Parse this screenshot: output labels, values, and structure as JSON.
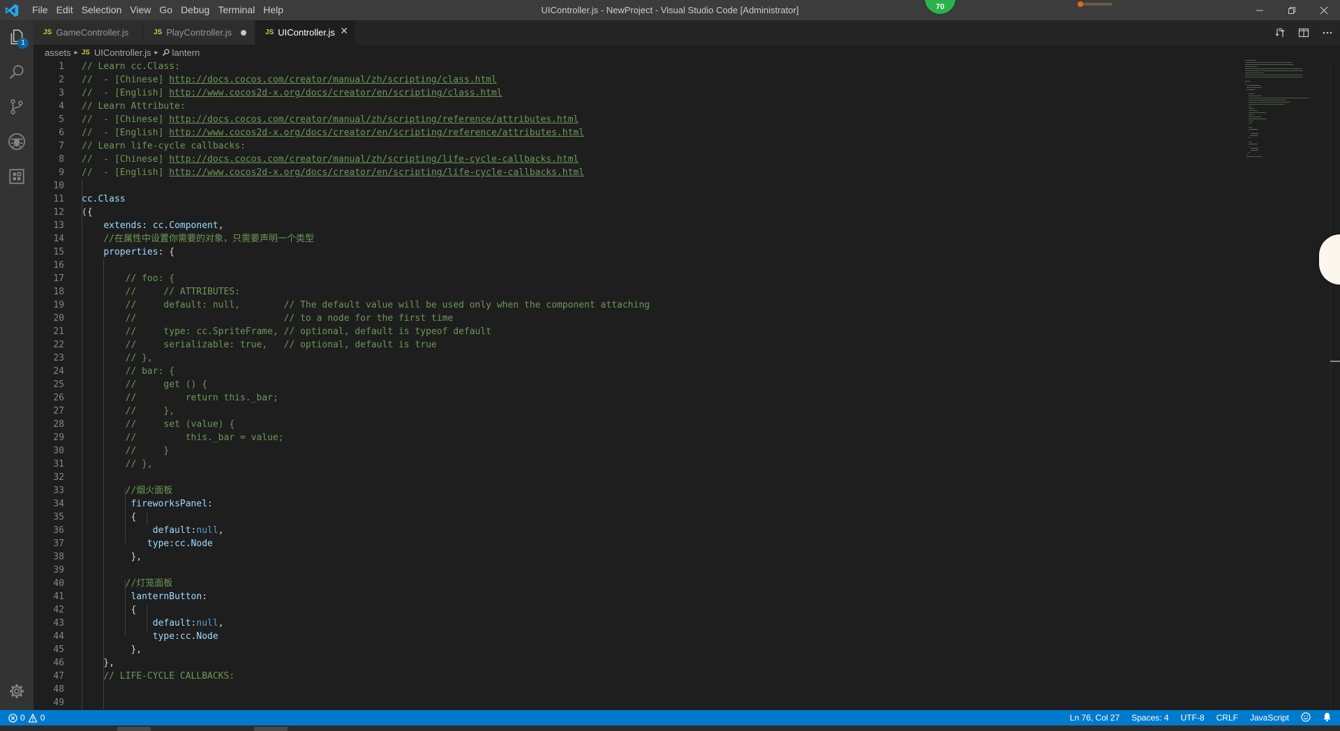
{
  "menu": [
    "File",
    "Edit",
    "Selection",
    "View",
    "Go",
    "Debug",
    "Terminal",
    "Help"
  ],
  "window_title": "UIController.js - NewProject - Visual Studio Code [Administrator]",
  "overlay_badge": "70",
  "activity": {
    "explorer_badge": "1"
  },
  "tabs": [
    {
      "label": "GameController.js",
      "icon": "JS",
      "state": "normal"
    },
    {
      "label": "PlayController.js",
      "icon": "JS",
      "state": "modified"
    },
    {
      "label": "UIController.js",
      "icon": "JS",
      "state": "active"
    }
  ],
  "breadcrumb": {
    "folder": "assets",
    "file": "UIController.js",
    "symbol": "lantern"
  },
  "code_lines": [
    {
      "n": "1",
      "segs": [
        [
          "com",
          "// Learn cc.Class:"
        ]
      ]
    },
    {
      "n": "2",
      "segs": [
        [
          "com",
          "//  - [Chinese] "
        ],
        [
          "link",
          "http://docs.cocos.com/creator/manual/zh/scripting/class.html"
        ]
      ]
    },
    {
      "n": "3",
      "segs": [
        [
          "com",
          "//  - [English] "
        ],
        [
          "link",
          "http://www.cocos2d-x.org/docs/creator/en/scripting/class.html"
        ]
      ]
    },
    {
      "n": "4",
      "segs": [
        [
          "com",
          "// Learn Attribute:"
        ]
      ]
    },
    {
      "n": "5",
      "segs": [
        [
          "com",
          "//  - [Chinese] "
        ],
        [
          "link",
          "http://docs.cocos.com/creator/manual/zh/scripting/reference/attributes.html"
        ]
      ]
    },
    {
      "n": "6",
      "segs": [
        [
          "com",
          "//  - [English] "
        ],
        [
          "link",
          "http://www.cocos2d-x.org/docs/creator/en/scripting/reference/attributes.html"
        ]
      ]
    },
    {
      "n": "7",
      "segs": [
        [
          "com",
          "// Learn life-cycle callbacks:"
        ]
      ]
    },
    {
      "n": "8",
      "segs": [
        [
          "com",
          "//  - [Chinese] "
        ],
        [
          "link",
          "http://docs.cocos.com/creator/manual/zh/scripting/life-cycle-callbacks.html"
        ]
      ]
    },
    {
      "n": "9",
      "segs": [
        [
          "com",
          "//  - [English] "
        ],
        [
          "link",
          "http://www.cocos2d-x.org/docs/creator/en/scripting/life-cycle-callbacks.html"
        ]
      ]
    },
    {
      "n": "10",
      "segs": []
    },
    {
      "n": "11",
      "segs": [
        [
          "prop",
          "cc"
        ],
        [
          "plain",
          "."
        ],
        [
          "prop",
          "Class"
        ]
      ]
    },
    {
      "n": "12",
      "segs": [
        [
          "plain",
          "({"
        ]
      ]
    },
    {
      "n": "13",
      "segs": [
        [
          "plain",
          "    "
        ],
        [
          "prop",
          "extends"
        ],
        [
          "plain",
          ": "
        ],
        [
          "prop",
          "cc"
        ],
        [
          "plain",
          "."
        ],
        [
          "prop",
          "Component"
        ],
        [
          "plain",
          ","
        ]
      ]
    },
    {
      "n": "14",
      "segs": [
        [
          "plain",
          "    "
        ],
        [
          "com",
          "//在属性中设置你需要的对象，只需要声明一个类型"
        ]
      ]
    },
    {
      "n": "15",
      "segs": [
        [
          "plain",
          "    "
        ],
        [
          "prop",
          "properties"
        ],
        [
          "plain",
          ": {"
        ]
      ]
    },
    {
      "n": "16",
      "segs": []
    },
    {
      "n": "17",
      "segs": [
        [
          "plain",
          "        "
        ],
        [
          "com",
          "// foo: {"
        ]
      ]
    },
    {
      "n": "18",
      "segs": [
        [
          "plain",
          "        "
        ],
        [
          "com",
          "//     // ATTRIBUTES:"
        ]
      ]
    },
    {
      "n": "19",
      "segs": [
        [
          "plain",
          "        "
        ],
        [
          "com",
          "//     default: null,        // The default value will be used only when the component attaching"
        ]
      ]
    },
    {
      "n": "20",
      "segs": [
        [
          "plain",
          "        "
        ],
        [
          "com",
          "//                           // to a node for the first time"
        ]
      ]
    },
    {
      "n": "21",
      "segs": [
        [
          "plain",
          "        "
        ],
        [
          "com",
          "//     type: cc.SpriteFrame, // optional, default is typeof default"
        ]
      ]
    },
    {
      "n": "22",
      "segs": [
        [
          "plain",
          "        "
        ],
        [
          "com",
          "//     serializable: true,   // optional, default is true"
        ]
      ]
    },
    {
      "n": "23",
      "segs": [
        [
          "plain",
          "        "
        ],
        [
          "com",
          "// },"
        ]
      ]
    },
    {
      "n": "24",
      "segs": [
        [
          "plain",
          "        "
        ],
        [
          "com",
          "// bar: {"
        ]
      ]
    },
    {
      "n": "25",
      "segs": [
        [
          "plain",
          "        "
        ],
        [
          "com",
          "//     get () {"
        ]
      ]
    },
    {
      "n": "26",
      "segs": [
        [
          "plain",
          "        "
        ],
        [
          "com",
          "//         return this._bar;"
        ]
      ]
    },
    {
      "n": "27",
      "segs": [
        [
          "plain",
          "        "
        ],
        [
          "com",
          "//     },"
        ]
      ]
    },
    {
      "n": "28",
      "segs": [
        [
          "plain",
          "        "
        ],
        [
          "com",
          "//     set (value) {"
        ]
      ]
    },
    {
      "n": "29",
      "segs": [
        [
          "plain",
          "        "
        ],
        [
          "com",
          "//         this._bar = value;"
        ]
      ]
    },
    {
      "n": "30",
      "segs": [
        [
          "plain",
          "        "
        ],
        [
          "com",
          "//     }"
        ]
      ]
    },
    {
      "n": "31",
      "segs": [
        [
          "plain",
          "        "
        ],
        [
          "com",
          "// },"
        ]
      ]
    },
    {
      "n": "32",
      "segs": []
    },
    {
      "n": "33",
      "segs": [
        [
          "plain",
          "        "
        ],
        [
          "com",
          "//烟火面板"
        ]
      ]
    },
    {
      "n": "34",
      "segs": [
        [
          "plain",
          "         "
        ],
        [
          "prop",
          "fireworksPanel"
        ],
        [
          "plain",
          ":"
        ]
      ]
    },
    {
      "n": "35",
      "segs": [
        [
          "plain",
          "         {"
        ]
      ]
    },
    {
      "n": "36",
      "segs": [
        [
          "plain",
          "             "
        ],
        [
          "prop",
          "default"
        ],
        [
          "plain",
          ":"
        ],
        [
          "key",
          "null"
        ],
        [
          "plain",
          ","
        ]
      ]
    },
    {
      "n": "37",
      "segs": [
        [
          "plain",
          "            "
        ],
        [
          "prop",
          "type"
        ],
        [
          "plain",
          ":"
        ],
        [
          "prop",
          "cc"
        ],
        [
          "plain",
          "."
        ],
        [
          "prop",
          "Node"
        ]
      ]
    },
    {
      "n": "38",
      "segs": [
        [
          "plain",
          "         },"
        ]
      ]
    },
    {
      "n": "39",
      "segs": []
    },
    {
      "n": "40",
      "segs": [
        [
          "plain",
          "        "
        ],
        [
          "com",
          "//灯笼面板"
        ]
      ]
    },
    {
      "n": "41",
      "segs": [
        [
          "plain",
          "         "
        ],
        [
          "prop",
          "lanternButton"
        ],
        [
          "plain",
          ":"
        ]
      ]
    },
    {
      "n": "42",
      "segs": [
        [
          "plain",
          "         {"
        ]
      ]
    },
    {
      "n": "43",
      "segs": [
        [
          "plain",
          "             "
        ],
        [
          "prop",
          "default"
        ],
        [
          "plain",
          ":"
        ],
        [
          "key",
          "null"
        ],
        [
          "plain",
          ","
        ]
      ]
    },
    {
      "n": "44",
      "segs": [
        [
          "plain",
          "             "
        ],
        [
          "prop",
          "type"
        ],
        [
          "plain",
          ":"
        ],
        [
          "prop",
          "cc"
        ],
        [
          "plain",
          "."
        ],
        [
          "prop",
          "Node"
        ]
      ]
    },
    {
      "n": "45",
      "segs": [
        [
          "plain",
          "         },"
        ]
      ]
    },
    {
      "n": "46",
      "segs": [
        [
          "plain",
          "    },"
        ]
      ]
    },
    {
      "n": "47",
      "segs": [
        [
          "plain",
          "    "
        ],
        [
          "com",
          "// LIFE-CYCLE CALLBACKS:"
        ]
      ]
    },
    {
      "n": "48",
      "segs": []
    },
    {
      "n": "49",
      "segs": []
    }
  ],
  "status": {
    "errors": "0",
    "warnings": "0",
    "position": "Ln 76, Col 27",
    "spaces": "Spaces: 4",
    "encoding": "UTF-8",
    "eol": "CRLF",
    "language": "JavaScript"
  },
  "colors": {
    "accent": "#007acc",
    "comment": "#6a9955",
    "variable": "#9cdcfe",
    "keyword": "#569cd6",
    "js_icon": "#cbcb41"
  },
  "icons": {
    "app": "vscode-logo-icon",
    "activity": [
      "files-icon",
      "search-icon",
      "source-control-icon",
      "debug-icon",
      "extensions-icon",
      "gear-icon"
    ],
    "editor_actions": [
      "open-changes-icon",
      "split-editor-icon",
      "more-icon"
    ],
    "status": [
      "error-icon",
      "warning-icon",
      "smiley-icon",
      "bell-icon"
    ]
  }
}
